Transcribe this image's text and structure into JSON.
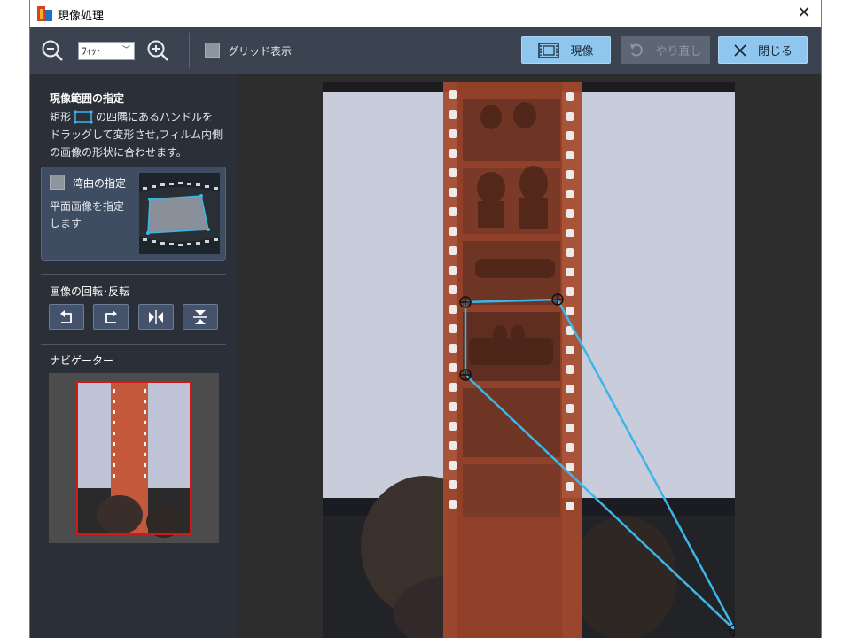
{
  "window": {
    "title": "現像処理"
  },
  "toolbar": {
    "zoom_value": "ﾌｨｯﾄ",
    "grid_label": "グリッド表示",
    "develop_label": "現像",
    "redo_label": "やり直し",
    "close_label": "閉じる"
  },
  "sidebar": {
    "range_title": "現像範囲の指定",
    "range_desc_1a": "矩形",
    "range_desc_1b": "の四隅にあるハンドルを",
    "range_desc_2": "ドラッグして変形させ,フィルム内側",
    "range_desc_3": "の画像の形状に合わせます。",
    "curve_label": "湾曲の指定",
    "curve_desc_1": "平面画像を指定",
    "curve_desc_2": "します",
    "rotate_title": "画像の回転･反転",
    "rotate_buttons": [
      "rotate-left",
      "rotate-right",
      "flip-horizontal",
      "flip-vertical"
    ],
    "navigator_title": "ナビゲーター"
  },
  "colors": {
    "accent": "#8fc6ee",
    "handle_line": "#3db5e6",
    "navigator_frame": "#d01818"
  }
}
